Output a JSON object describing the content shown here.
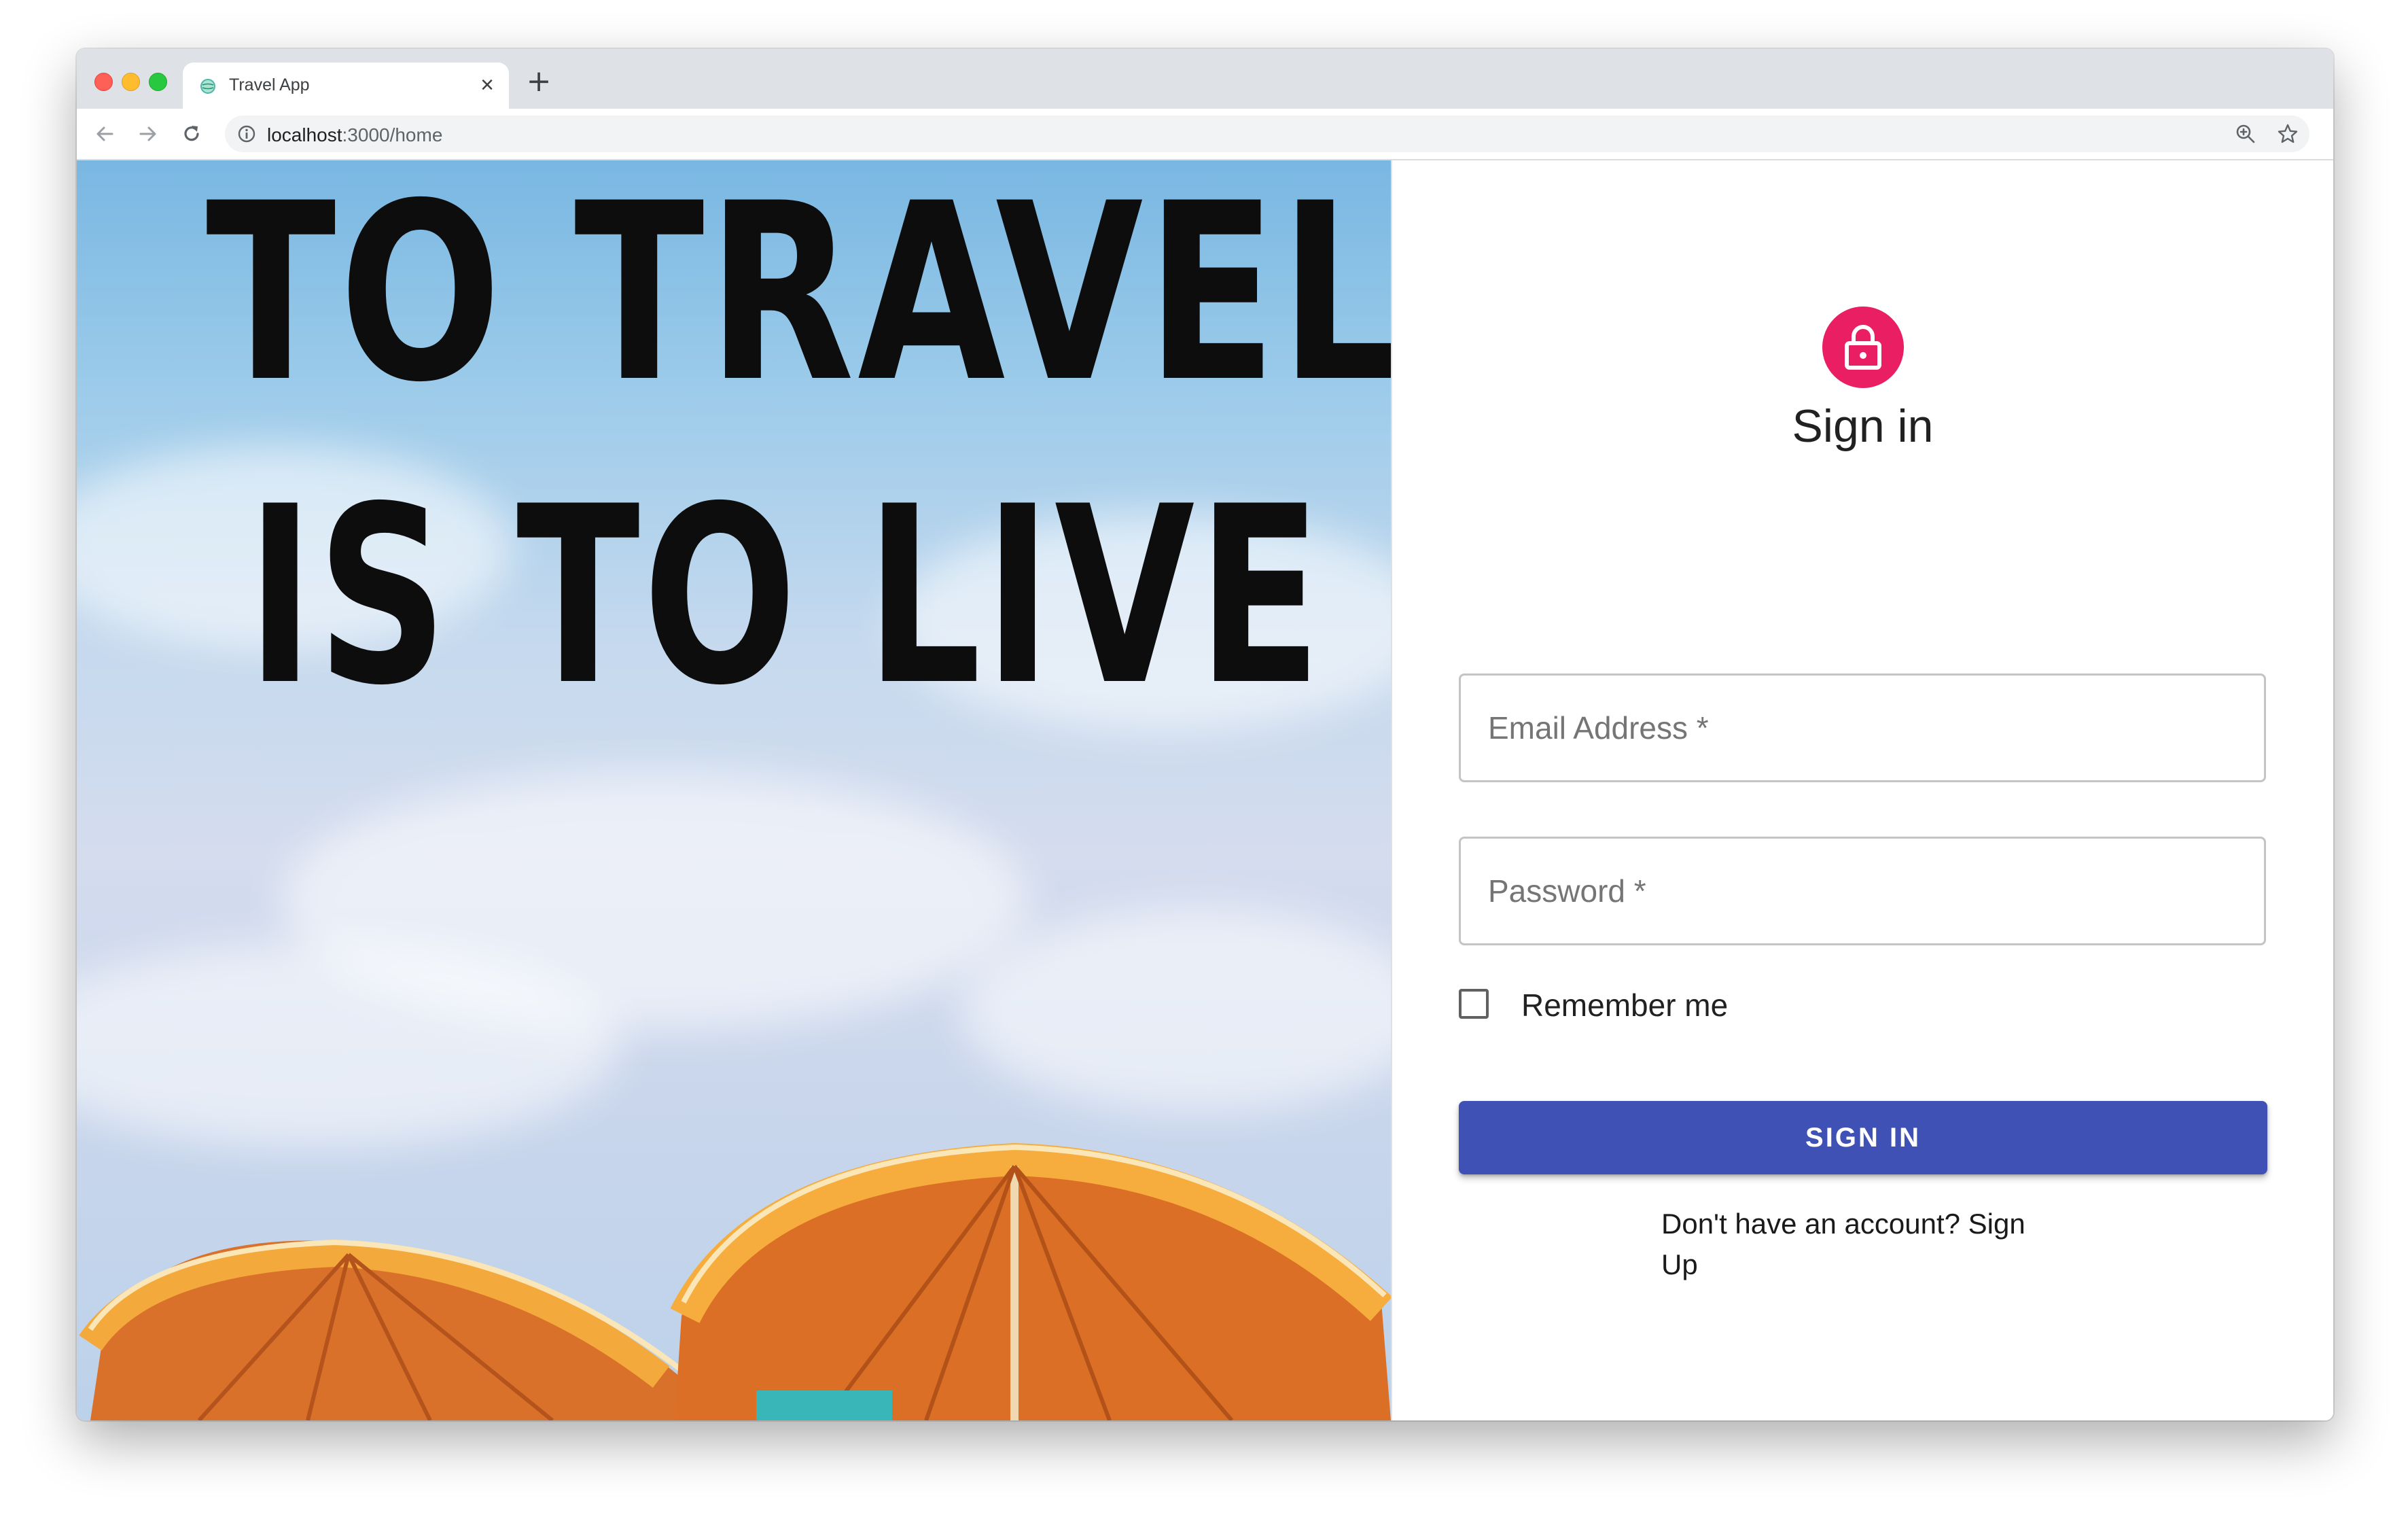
{
  "browser": {
    "tab_title": "Travel App",
    "tab_close": "×",
    "new_tab": "+",
    "url_host": "localhost",
    "url_path": ":3000/home"
  },
  "hero": {
    "line1": "TO TRAVEL",
    "line2": "IS TO LIVE"
  },
  "signin": {
    "title": "Sign in",
    "email_placeholder": "Email Address *",
    "password_placeholder": "Password *",
    "remember_label": "Remember me",
    "button_label": "SIGN IN",
    "signup_link": "Don't have an account? Sign Up"
  },
  "colors": {
    "avatar_bg": "#e91e63",
    "primary_button": "#3f51b5"
  },
  "icons": {
    "avatar": "lock-icon",
    "favicon": "globe-icon"
  }
}
